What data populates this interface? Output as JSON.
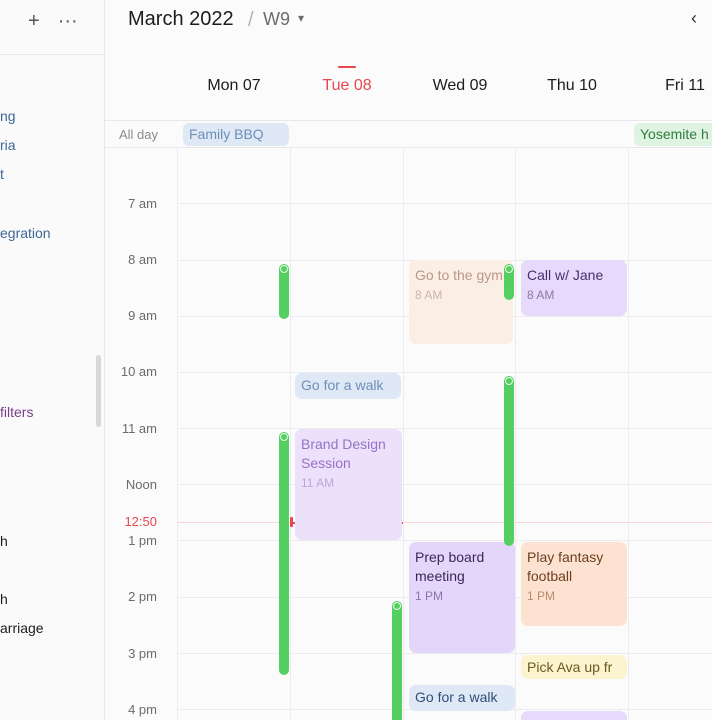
{
  "sidebar": {
    "add_icon": "plus-icon",
    "more_icon": "ellipsis-icon",
    "items": [
      {
        "label": "ng",
        "style": "blue"
      },
      {
        "label": "ria",
        "style": "blue"
      },
      {
        "label": "t",
        "style": "blue"
      },
      {
        "label": "egration",
        "style": "blue"
      },
      {
        "label": "filters",
        "style": "purple"
      },
      {
        "label": "h",
        "style": "dark"
      },
      {
        "label": "h",
        "style": "dark"
      },
      {
        "label": "arriage",
        "style": "dark"
      }
    ]
  },
  "header": {
    "month": "March 2022",
    "separator": "/",
    "week": "W9",
    "week_caret": "▾",
    "prev_icon": "‹",
    "days": [
      {
        "label": "Mon 07",
        "today": false
      },
      {
        "label": "Tue 08",
        "today": true
      },
      {
        "label": "Wed 09",
        "today": false
      },
      {
        "label": "Thu 10",
        "today": false
      },
      {
        "label": "Fri 11",
        "today": false
      }
    ]
  },
  "allday": {
    "label": "All day",
    "events": [
      {
        "title": "Family BBQ",
        "day": 0
      },
      {
        "title": "Yosemite h",
        "day": 4
      }
    ]
  },
  "grid": {
    "hours": [
      "7 am",
      "8 am",
      "9 am",
      "10 am",
      "11 am",
      "Noon",
      "1 pm",
      "2 pm",
      "3 pm",
      "4 pm"
    ],
    "now_label": "12:50"
  },
  "events": [
    {
      "title": "Go to the gym",
      "time": "8 AM",
      "day": 2
    },
    {
      "title": "Call w/ Jane",
      "time": "8 AM",
      "day": 3
    },
    {
      "title": "Go for a walk",
      "time": "",
      "day": 1
    },
    {
      "title": "Brand Design Session",
      "time": "11 AM",
      "day": 1
    },
    {
      "title": "Prep board meeting",
      "time": "1 PM",
      "day": 2
    },
    {
      "title": "Play fantasy football",
      "time": "1 PM",
      "day": 3
    },
    {
      "title": "Pick Ava up fr",
      "time": "",
      "day": 3
    },
    {
      "title": "Go for a walk",
      "time": "",
      "day": 2
    }
  ],
  "colors": {
    "today": "#e5484d",
    "track_green": "#55cf62",
    "blue_event": "#dfe9f6",
    "purple_event": "#e7d9fb",
    "peach_event": "#fbeee4",
    "orange_event": "#fde2d1",
    "yellow_event": "#fcf3cf",
    "green_event": "#dff3e2"
  }
}
